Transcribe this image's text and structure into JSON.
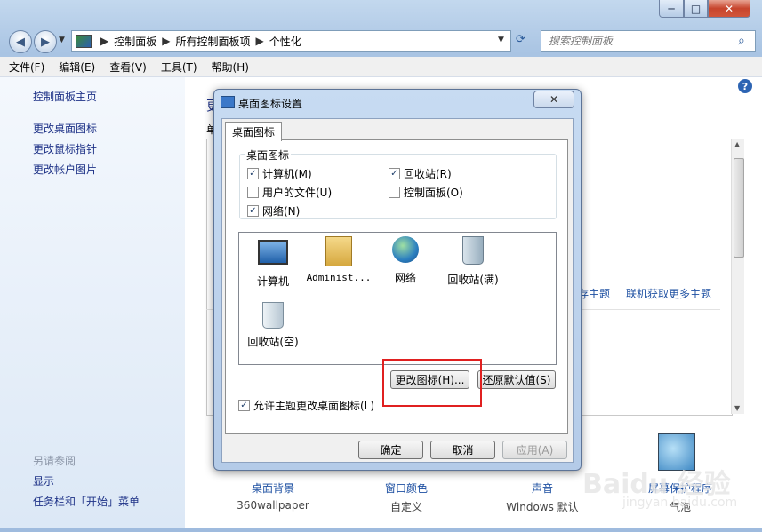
{
  "address": {
    "crumbs": [
      "控制面板",
      "所有控制面板项",
      "个性化"
    ]
  },
  "search": {
    "placeholder": "搜索控制面板"
  },
  "menu": [
    "文件(F)",
    "编辑(E)",
    "查看(V)",
    "工具(T)",
    "帮助(H)"
  ],
  "sidebar": {
    "home": "控制面板主页",
    "links": [
      "更改桌面图标",
      "更改鼠标指针",
      "更改帐户图片"
    ],
    "see_also_title": "另请参阅",
    "see_also": [
      "显示",
      "任务栏和「开始」菜单"
    ]
  },
  "main": {
    "heading_fragment": "更",
    "subheading_fragment": "单",
    "theme_links": [
      "存主题",
      "联机获取更多主题"
    ],
    "bottom": [
      {
        "label": "桌面背景",
        "sub": "360wallpaper"
      },
      {
        "label": "窗口颜色",
        "sub": "自定义"
      },
      {
        "label": "声音",
        "sub": "Windows 默认"
      },
      {
        "label": "屏幕保护程序",
        "sub": "气泡"
      }
    ]
  },
  "dialog": {
    "title": "桌面图标设置",
    "tab": "桌面图标",
    "group_title": "桌面图标",
    "checkboxes": [
      {
        "label": "计算机(M)",
        "checked": true
      },
      {
        "label": "回收站(R)",
        "checked": true
      },
      {
        "label": "用户的文件(U)",
        "checked": false
      },
      {
        "label": "控制面板(O)",
        "checked": false
      },
      {
        "label": "网络(N)",
        "checked": true
      }
    ],
    "icons": [
      "计算机",
      "Administ...",
      "网络",
      "回收站(满)",
      "回收站(空)"
    ],
    "change_icon": "更改图标(H)...",
    "restore_default": "还原默认值(S)",
    "allow_theme": "允许主题更改桌面图标(L)",
    "allow_theme_checked": true,
    "ok": "确定",
    "cancel": "取消",
    "apply": "应用(A)"
  },
  "watermark": {
    "logo": "Baidu 经验",
    "url": "jingyan.baidu.com"
  },
  "colors": {
    "link": "#1e50a2",
    "highlight": "#e02020"
  }
}
